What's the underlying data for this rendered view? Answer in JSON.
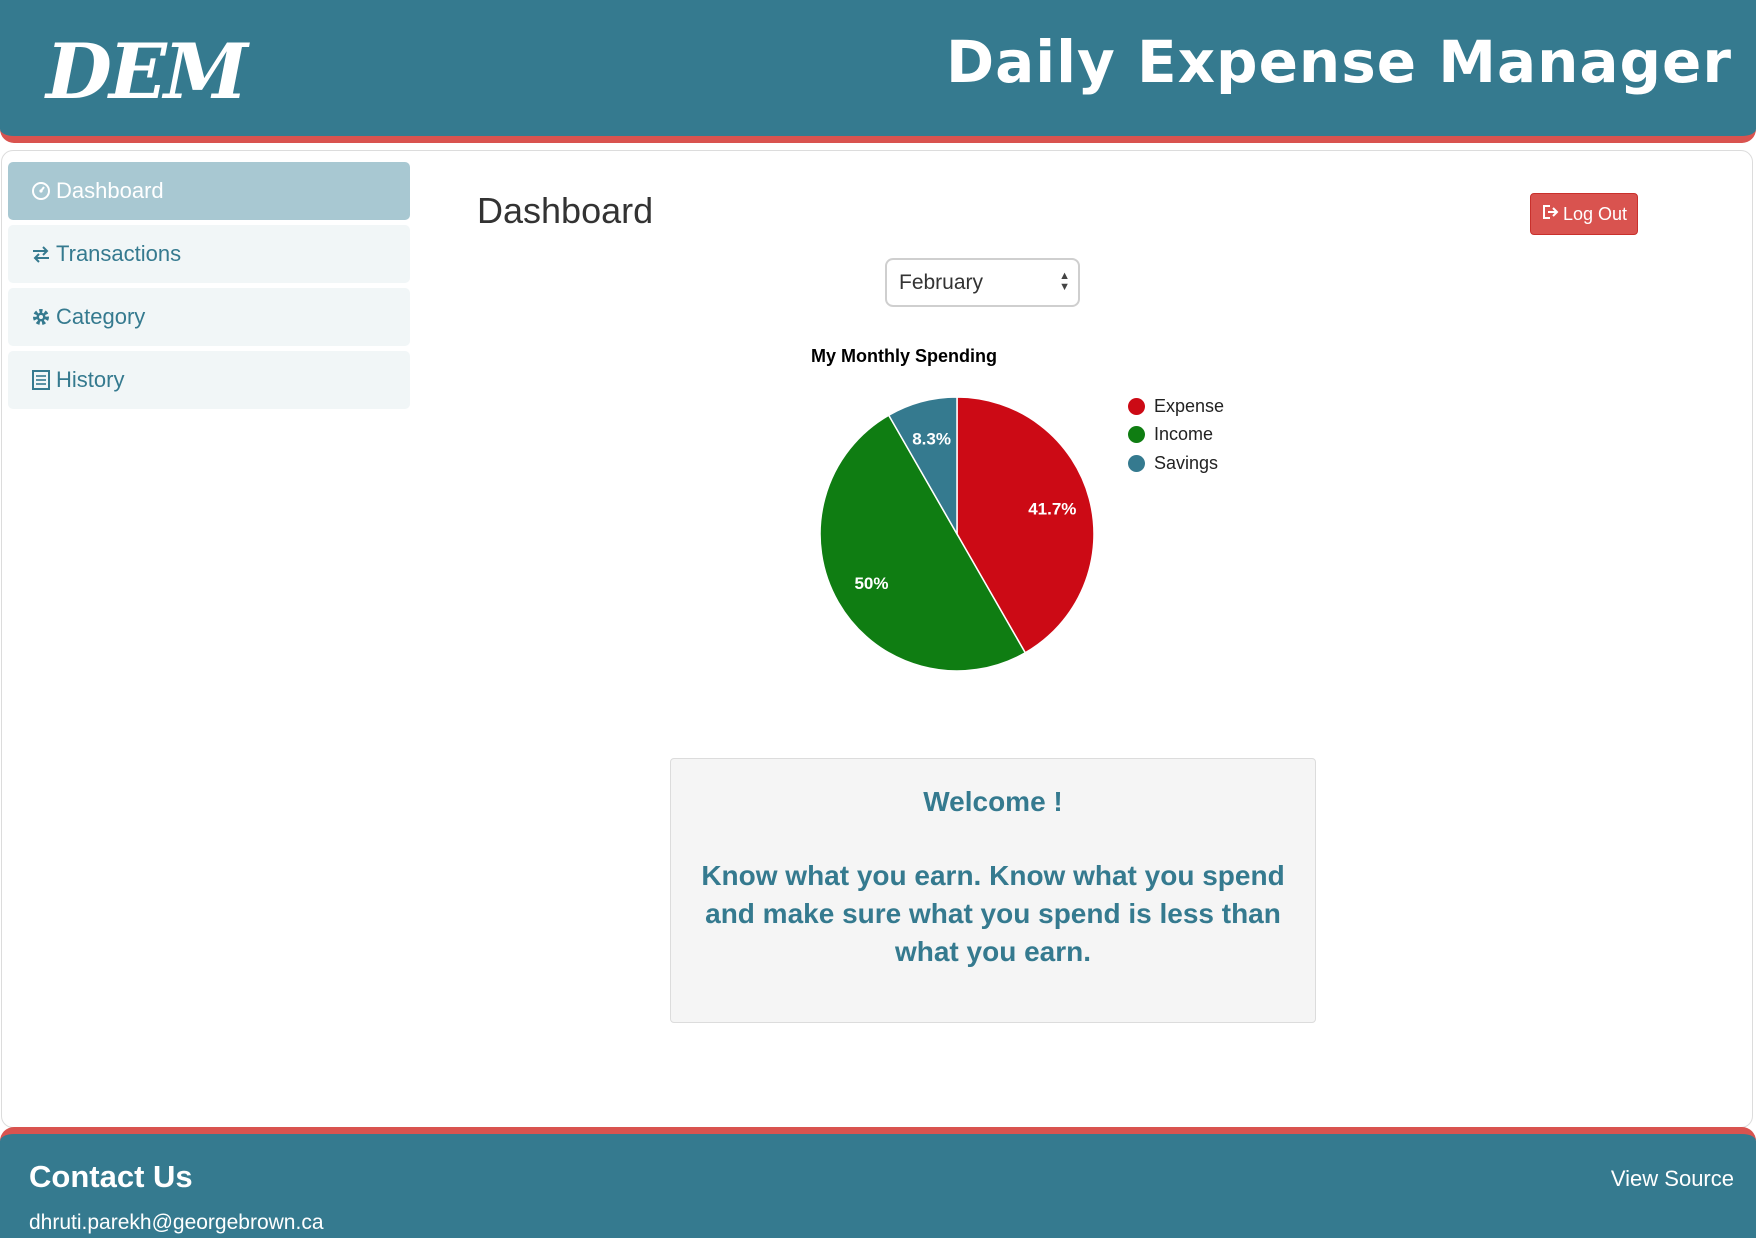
{
  "header": {
    "logo": "DEM",
    "title": "Daily Expense Manager"
  },
  "sidebar": {
    "items": [
      {
        "label": "Dashboard",
        "icon": "dashboard-icon",
        "active": true
      },
      {
        "label": "Transactions",
        "icon": "transfer-arrows-icon",
        "active": false
      },
      {
        "label": "Category",
        "icon": "gear-icon",
        "active": false
      },
      {
        "label": "History",
        "icon": "list-icon",
        "active": false
      }
    ]
  },
  "main": {
    "title": "Dashboard",
    "logout_label": "Log Out",
    "month_select": {
      "value": "February"
    }
  },
  "colors": {
    "brand": "#357a8f",
    "accent": "#d9534f",
    "expense": "#cc0a15",
    "income": "#0f7d12",
    "savings": "#357a8f"
  },
  "chart_data": {
    "type": "pie",
    "title": "My Monthly Spending",
    "categories": [
      "Expense",
      "Income",
      "Savings"
    ],
    "values": [
      41.7,
      50,
      8.3
    ],
    "labels": [
      "41.7%",
      "50%",
      "8.3%"
    ],
    "colors": [
      "#cc0a15",
      "#0f7d12",
      "#357a8f"
    ],
    "legend": "right"
  },
  "welcome": {
    "title": "Welcome !",
    "body": "Know what you earn. Know what you spend and make sure what you spend is less than what you earn."
  },
  "footer": {
    "title": "Contact Us",
    "link": "View Source",
    "email": "dhruti.parekh@georgebrown.ca"
  }
}
